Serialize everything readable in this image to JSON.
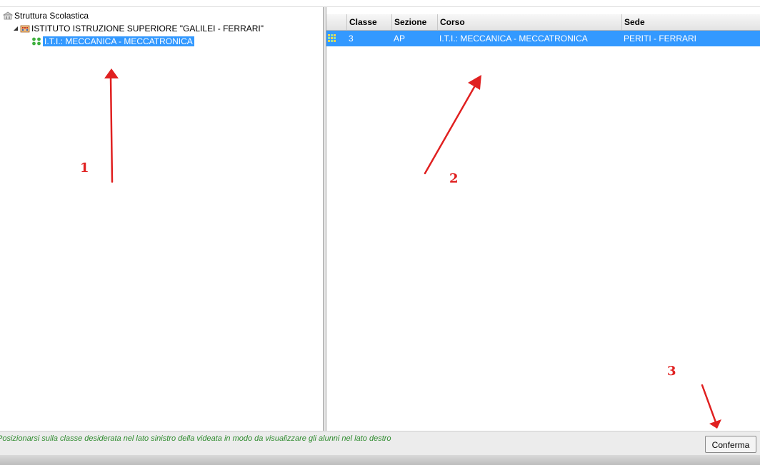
{
  "tree": {
    "root_label": "Struttura Scolastica",
    "school_label": "ISTITUTO ISTRUZIONE SUPERIORE \"GALILEI - FERRARI\"",
    "course_label": "I.T.I.: MECCANICA - MECCATRONICA"
  },
  "grid": {
    "columns": [
      "Classe",
      "Sezione",
      "Corso",
      "Sede"
    ],
    "rows": [
      {
        "classe": "3",
        "sezione": "AP",
        "corso": "I.T.I.: MECCANICA - MECCATRONICA",
        "sede": "PERITI - FERRARI"
      }
    ]
  },
  "status": {
    "message": "Posizionarsi sulla classe desiderata nel lato sinistro della videata in modo da visualizzare gli alunni nel lato destro"
  },
  "buttons": {
    "confirm_label": "Conferma"
  },
  "annotations": {
    "labels": [
      "1",
      "2",
      "3"
    ],
    "color": "#e02020"
  },
  "colors": {
    "selection": "#3399ff",
    "status_text": "#2e8b2e"
  }
}
